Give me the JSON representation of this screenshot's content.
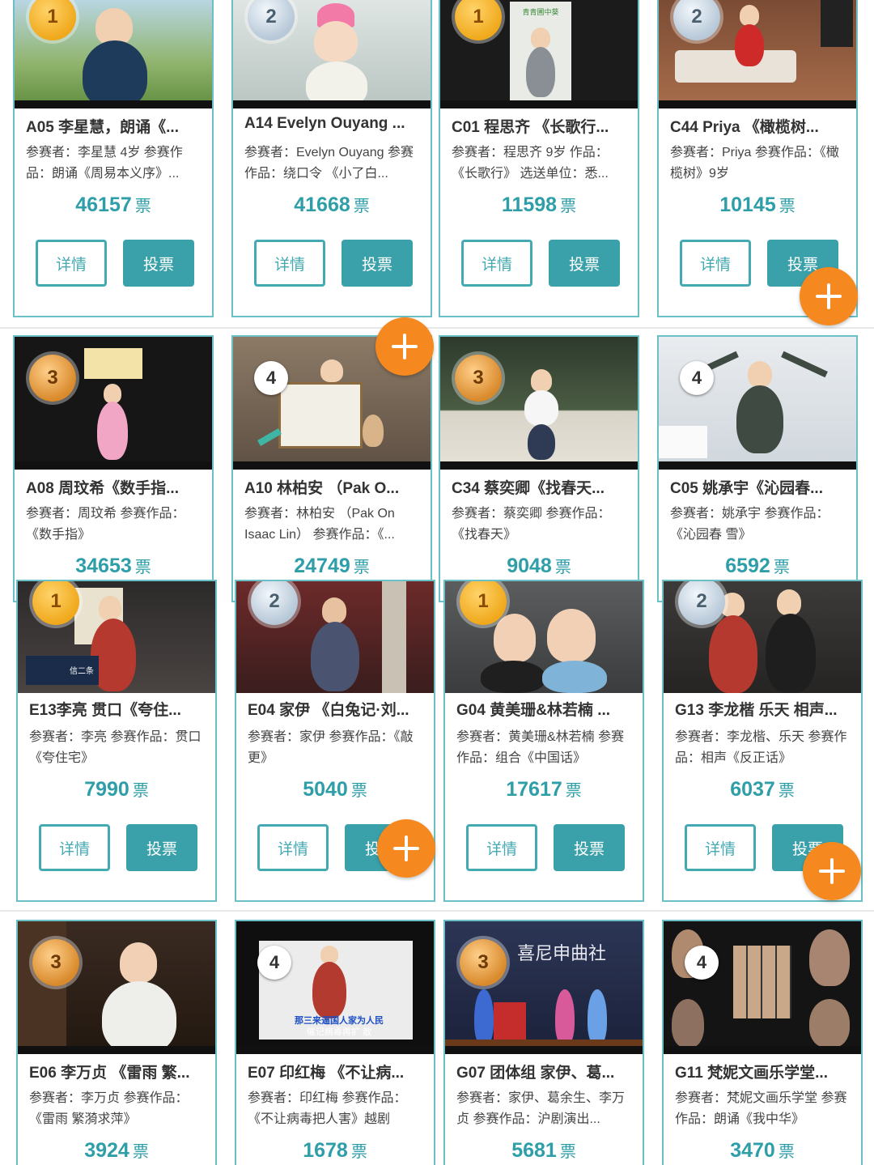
{
  "labels": {
    "detail": "详情",
    "vote": "投票",
    "votes_unit": "票"
  },
  "cards": [
    {
      "rank": "1",
      "title": "A05 李星慧，朗诵《...",
      "desc": "参赛者：李星慧 4岁 参赛作品：朗诵《周易本义序》...",
      "votes": "46157"
    },
    {
      "rank": "2",
      "title": "A14 Evelyn Ouyang ...",
      "desc": "参赛者：Evelyn Ouyang 参赛作品：绕口令 《小了白...",
      "votes": "41668"
    },
    {
      "rank": "1",
      "title": "C01 程思齐 《长歌行...",
      "desc": "参赛者：程思齐 9岁 作品：《长歌行》 选送单位：悉...",
      "votes": "11598"
    },
    {
      "rank": "2",
      "title": "C44 Priya 《橄榄树...",
      "desc": "参赛者：Priya 参赛作品：《橄榄树》9岁",
      "votes": "10145"
    },
    {
      "rank": "3",
      "title": "A08 周玟希《数手指...",
      "desc": "参赛者：周玟希 参赛作品：《数手指》",
      "votes": "34653"
    },
    {
      "rank": "4",
      "title": "A10 林柏安 （Pak O...",
      "desc": "参赛者：林柏安 （Pak On Isaac Lin） 参赛作品：《...",
      "votes": "24749"
    },
    {
      "rank": "3",
      "title": "C34 蔡奕卿《找春天...",
      "desc": "参赛者：蔡奕卿 参赛作品：《找春天》",
      "votes": "9048"
    },
    {
      "rank": "4",
      "title": "C05 姚承宇《沁园春...",
      "desc": "参赛者：姚承宇 参赛作品：《沁园春 雪》",
      "votes": "6592"
    },
    {
      "rank": "1",
      "title": "E13李亮 贯口《夸住...",
      "desc": "参赛者：李亮 参赛作品：贯口《夸住宅》",
      "votes": "7990"
    },
    {
      "rank": "2",
      "title": "E04 家伊 《白兔记·刘...",
      "desc": "参赛者：家伊 参赛作品：《敲更》",
      "votes": "5040"
    },
    {
      "rank": "1",
      "title": "G04 黄美珊&林若楠 ...",
      "desc": "参赛者：黄美珊&林若楠 参赛作品：组合《中国话》",
      "votes": "17617"
    },
    {
      "rank": "2",
      "title": "G13 李龙楷 乐天 相声...",
      "desc": "参赛者：李龙楷、乐天 参赛作品：相声《反正话》",
      "votes": "6037"
    },
    {
      "rank": "3",
      "title": "E06 李万贞 《雷雨 繁...",
      "desc": "参赛者：李万贞 参赛作品：《雷雨 繁漪求萍》",
      "votes": "3924"
    },
    {
      "rank": "4",
      "title": "E07 印红梅 《不让病...",
      "desc": "参赛者：印红梅 参赛作品：《不让病毒把人害》越剧",
      "votes": "1678"
    },
    {
      "rank": "3",
      "title": "G07 团体组 家伊、葛...",
      "desc": "参赛者：家伊、葛余生、李万贞 参赛作品：沪剧演出...",
      "votes": "5681"
    },
    {
      "rank": "4",
      "title": "G11 梵妮文画乐学堂...",
      "desc": "参赛者：梵妮文画乐学堂 参赛作品：朗诵《我中华》",
      "votes": "3470"
    }
  ],
  "thumb_captions": {
    "c3": "青青圃中葵",
    "c9": "信二条",
    "c14_line1": "那三来逼国人家为人民",
    "c14_line2": "催记病毒再扩 散",
    "c15": "喜尼申曲社"
  },
  "colors": {
    "accent": "#3aa1ab",
    "border": "#6bbfc6",
    "plus": "#f5891f"
  }
}
